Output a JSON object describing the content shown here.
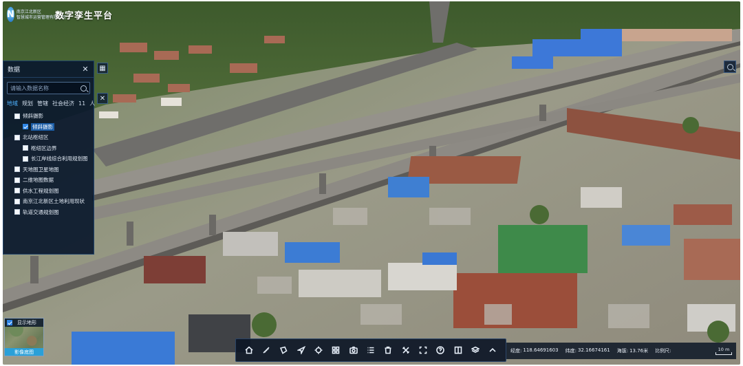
{
  "app": {
    "logo_glyph": "N",
    "logo_lines": [
      "南京江北新区",
      "智慧城市运营管理有限公司"
    ],
    "title": "数字孪生平台"
  },
  "layer_panel": {
    "title": "数据",
    "close_icon": "close-icon",
    "search_placeholder": "请输入数据名称",
    "tabs": [
      {
        "label": "地域",
        "active": true
      },
      {
        "label": "规划",
        "active": false
      },
      {
        "label": "管辖",
        "active": false
      },
      {
        "label": "社会经济",
        "active": false
      },
      {
        "label": "11",
        "active": false
      },
      {
        "label": "人",
        "active": false
      }
    ],
    "tree": [
      {
        "label": "倾斜摄影",
        "checked": false,
        "level": 1
      },
      {
        "label": "倾斜摄影",
        "checked": true,
        "level": 2,
        "selected": true
      },
      {
        "label": "北站枢纽区",
        "checked": false,
        "level": 1
      },
      {
        "label": "枢纽区边界",
        "checked": false,
        "level": 2
      },
      {
        "label": "长江岸线综合利用规划图",
        "checked": false,
        "level": 2
      },
      {
        "label": "天地图卫星地图",
        "checked": false,
        "level": 1
      },
      {
        "label": "二维地图数据",
        "checked": false,
        "level": 1
      },
      {
        "label": "供水工程规划图",
        "checked": false,
        "level": 1
      },
      {
        "label": "南京江北新区土地利用现状",
        "checked": false,
        "level": 1
      },
      {
        "label": "轨道交通规划图",
        "checked": false,
        "level": 1
      }
    ]
  },
  "minimap": {
    "toggle_label": "显示地形",
    "toggle_checked": true,
    "label": "影像底图"
  },
  "toolbar": {
    "tools": [
      {
        "name": "home-icon"
      },
      {
        "name": "measure-icon"
      },
      {
        "name": "area-icon"
      },
      {
        "name": "navigate-icon"
      },
      {
        "name": "locate-icon"
      },
      {
        "name": "grid-icon"
      },
      {
        "name": "camera-icon"
      },
      {
        "name": "list-icon"
      },
      {
        "name": "trash-icon"
      },
      {
        "name": "tools-icon"
      },
      {
        "name": "fullscreen-icon"
      },
      {
        "name": "help-icon"
      },
      {
        "name": "split-icon"
      },
      {
        "name": "layers-icon"
      },
      {
        "name": "more-icon"
      }
    ]
  },
  "status": {
    "longitude_label": "经度:",
    "longitude_value": "118.64691603",
    "latitude_label": "纬度:",
    "latitude_value": "32.16674161",
    "altitude_label": "海拔:",
    "altitude_value": "13.76米",
    "scale_label": "比例尺:",
    "scale_value": "10 m"
  },
  "colors": {
    "panel_bg": "#0a182c",
    "accent": "#2f86e6",
    "active_tab": "#4fb2ff"
  }
}
